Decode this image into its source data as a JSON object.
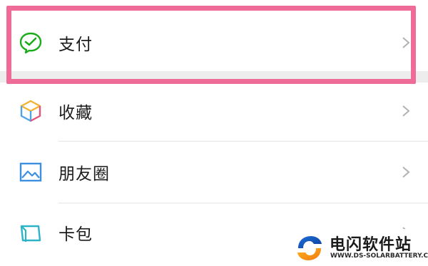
{
  "menu": {
    "items": [
      {
        "label": "支付",
        "icon": "wechat-pay-icon"
      },
      {
        "label": "收藏",
        "icon": "favorites-cube-icon"
      },
      {
        "label": "朋友圈",
        "icon": "moments-landscape-icon"
      },
      {
        "label": "卡包",
        "icon": "card-wallet-icon"
      }
    ]
  },
  "colors": {
    "highlight": "#ef6c98",
    "pay_green": "#1aad19",
    "chevron": "#b2b2b2"
  },
  "watermark": {
    "title": "电闪软件站",
    "subtitle": "WWW.DS-SOLARBATTERY.COM"
  }
}
